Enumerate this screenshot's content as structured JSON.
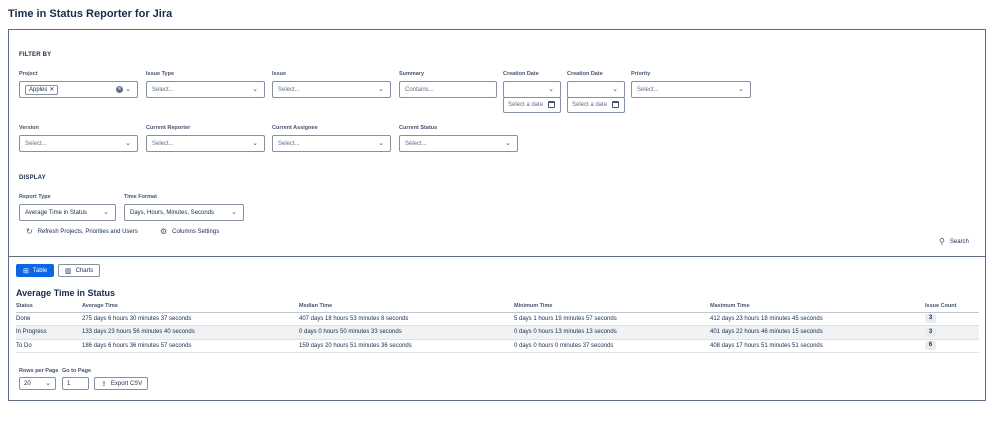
{
  "app": {
    "title": "Time in Status Reporter for Jira"
  },
  "filters": {
    "section_label": "FILTER BY",
    "project": {
      "label": "Project",
      "tag": "Apples"
    },
    "issue_type": {
      "label": "Issue Type",
      "placeholder": "Select..."
    },
    "issue": {
      "label": "Issue",
      "placeholder": "Select..."
    },
    "summary": {
      "label": "Summary",
      "placeholder": "Contains..."
    },
    "creation_date_from": {
      "label": "Creation Date",
      "date_placeholder": "Select a date"
    },
    "creation_date_to": {
      "label": "Creation Date",
      "date_placeholder": "Select a date"
    },
    "priority": {
      "label": "Priority",
      "placeholder": "Select..."
    },
    "version": {
      "label": "Version",
      "placeholder": "Select..."
    },
    "current_reporter": {
      "label": "Current Reporter",
      "placeholder": "Select..."
    },
    "current_assignee": {
      "label": "Current Assignee",
      "placeholder": "Select..."
    },
    "current_status": {
      "label": "Current Status",
      "placeholder": "Select..."
    }
  },
  "display": {
    "section_label": "DISPLAY",
    "report_type": {
      "label": "Report Type",
      "value": "Average Time in Status"
    },
    "time_format": {
      "label": "Time Format",
      "value": "Days, Hours, Minutes, Seconds"
    },
    "refresh_label": "Refresh Projects, Priorities and Users",
    "columns_settings_label": "Columns Settings",
    "search_label": "Search"
  },
  "view_tabs": [
    {
      "label": "Table",
      "active": true,
      "icon": "table-icon"
    },
    {
      "label": "Charts",
      "active": false,
      "icon": "bar-chart-icon"
    }
  ],
  "report": {
    "title": "Average Time in Status",
    "columns": [
      "Status",
      "Average Time",
      "Median Time",
      "Minimum Time",
      "Maximum Time",
      "Issue Count"
    ],
    "rows": [
      [
        "Done",
        "275 days 6 hours 30 minutes 37 seconds",
        "407 days 18 hours 53 minutes 8 seconds",
        "5 days 1 hours 19 minutes 57 seconds",
        "412 days 23 hours 18 minutes 45 seconds",
        "3"
      ],
      [
        "In Progress",
        "133 days 23 hours 56 minutes 40 seconds",
        "0 days 0 hours 50 minutes 33 seconds",
        "0 days 0 hours 13 minutes 13 seconds",
        "401 days 22 hours 46 minutes 15 seconds",
        "3"
      ],
      [
        "To Do",
        "186 days 6 hours 36 minutes 57 seconds",
        "159 days 20 hours 51 minutes 36 seconds",
        "0 days 0 hours 0 minutes 37 seconds",
        "408 days 17 hours 51 minutes 51 seconds",
        "6"
      ]
    ]
  },
  "pagination": {
    "rows_per_page_label": "Rows per Page",
    "rows_per_page_value": "20",
    "go_to_page_label": "Go to Page",
    "go_to_page_value": "1",
    "export_label": "Export CSV"
  }
}
